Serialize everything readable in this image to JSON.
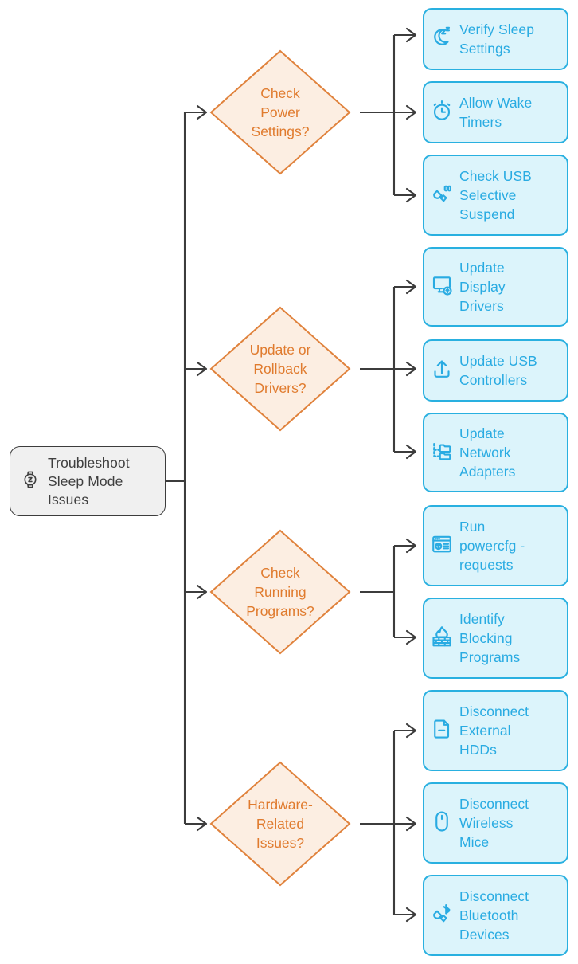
{
  "diagram": {
    "title": "Troubleshoot Sleep Mode Issues",
    "colors": {
      "root_fill": "#f0f0f0",
      "root_stroke": "#3c3c3c",
      "root_text": "#3f3f3f",
      "decision_fill": "#fceee2",
      "decision_stroke": "#e0823c",
      "decision_text": "#e07b2e",
      "leaf_fill": "#dcf4fb",
      "leaf_stroke": "#29b0e0",
      "leaf_text": "#29abe2",
      "connector": "#3c3c3c"
    }
  },
  "root": {
    "label": "Troubleshoot\nSleep Mode\nIssues",
    "icon": "smartwatch-sleep-icon"
  },
  "branches": [
    {
      "id": "power-settings",
      "label": "Check\nPower\nSettings?",
      "leaves": [
        {
          "id": "verify-sleep-settings",
          "label": "Verify Sleep\nSettings",
          "icon": "moon-zz-icon"
        },
        {
          "id": "allow-wake-timers",
          "label": "Allow Wake\nTimers",
          "icon": "alarm-clock-icon"
        },
        {
          "id": "check-usb-selective-suspend",
          "label": "Check USB\nSelective\nSuspend",
          "icon": "usb-plug-icon"
        }
      ]
    },
    {
      "id": "update-rollback-drivers",
      "label": "Update or\nRollback\nDrivers?",
      "leaves": [
        {
          "id": "update-display-drivers",
          "label": "Update\nDisplay\nDrivers",
          "icon": "monitor-upload-icon"
        },
        {
          "id": "update-usb-controllers",
          "label": "Update USB\nControllers",
          "icon": "upload-arrow-icon"
        },
        {
          "id": "update-network-adapters",
          "label": "Update\nNetwork\nAdapters",
          "icon": "network-tree-icon"
        }
      ]
    },
    {
      "id": "check-running-programs",
      "label": "Check\nRunning\nProgrammes?",
      "leaves": [
        {
          "id": "run-powercfg-requests",
          "label": "Run\npowercfg -\nrequests",
          "icon": "console-window-icon"
        },
        {
          "id": "identify-blocking-programs",
          "label": "Identify\nBlocking\nPrograms",
          "icon": "firewall-icon"
        }
      ]
    },
    {
      "id": "hardware-related-issues",
      "label": "Hardware-\nRelated\nIssues?",
      "leaves": [
        {
          "id": "disconnect-external-hdds",
          "label": "Disconnect\nExternal\nHDDs",
          "icon": "file-minus-icon"
        },
        {
          "id": "disconnect-wireless-mice",
          "label": "Disconnect\nWireless\nMice",
          "icon": "mouse-icon"
        },
        {
          "id": "disconnect-bluetooth-devices",
          "label": "Disconnect\nBluetooth\nDevices",
          "icon": "bluetooth-plug-icon"
        }
      ]
    }
  ],
  "branch_label_overrides": {
    "check-running-programs": "Check\nRunning\nPrograms?"
  }
}
